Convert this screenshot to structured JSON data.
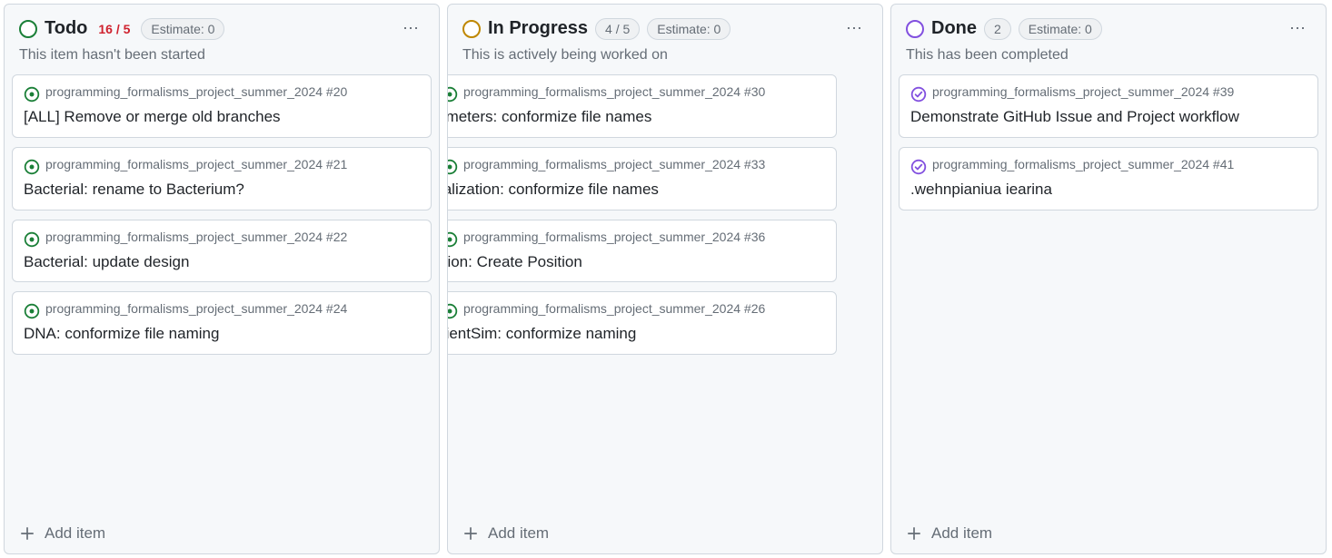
{
  "columns": [
    {
      "id": "todo",
      "status": "green",
      "title": "Todo",
      "count": "16 / 5",
      "count_style": "red",
      "estimate": "Estimate: 0",
      "desc": "This item hasn't been started",
      "add_label": "Add item",
      "cards": [
        {
          "repo": "programming_formalisms_project_summer_2024",
          "num": "#20",
          "title": "[ALL] Remove or merge old branches",
          "state": "open"
        },
        {
          "repo": "programming_formalisms_project_summer_2024",
          "num": "#21",
          "title": "Bacterial: rename to Bacterium?",
          "state": "open"
        },
        {
          "repo": "programming_formalisms_project_summer_2024",
          "num": "#22",
          "title": "Bacterial: update design",
          "state": "open"
        },
        {
          "repo": "programming_formalisms_project_summer_2024",
          "num": "#24",
          "title": "DNA: conformize file naming",
          "state": "open"
        }
      ]
    },
    {
      "id": "inprogress",
      "status": "yellow",
      "title": "In Progress",
      "count": "4 / 5",
      "count_style": "grey",
      "estimate": "Estimate: 0",
      "desc": "This is actively being worked on",
      "add_label": "Add item",
      "cards": [
        {
          "repo": "programming_formalisms_project_summer_2024",
          "num": "#30",
          "title": "arameters: conformize file names",
          "state": "open",
          "avatar": "badge1"
        },
        {
          "repo": "programming_formalisms_project_summer_2024",
          "num": "#33",
          "title": "isualization: conformize file names",
          "state": "open",
          "avatar": "badge2"
        },
        {
          "repo": "programming_formalisms_project_summer_2024",
          "num": "#36",
          "title": "osition: Create Position",
          "state": "open",
          "avatar": "badge3"
        },
        {
          "repo": "programming_formalisms_project_summer_2024",
          "num": "#26",
          "title": "radientSim: conformize naming",
          "state": "open",
          "avatar": "badge4"
        }
      ]
    },
    {
      "id": "done",
      "status": "purple",
      "title": "Done",
      "count": "2",
      "count_style": "grey",
      "estimate": "Estimate: 0",
      "desc": "This has been completed",
      "add_label": "Add item",
      "cards": [
        {
          "repo": "programming_formalisms_project_summer_2024",
          "num": "#39",
          "title": "Demonstrate GitHub Issue and Project workflow",
          "state": "closed"
        },
        {
          "repo": "programming_formalisms_project_summer_2024",
          "num": "#41",
          "title": ".wehnpianiua iearina",
          "state": "closed"
        }
      ]
    }
  ]
}
